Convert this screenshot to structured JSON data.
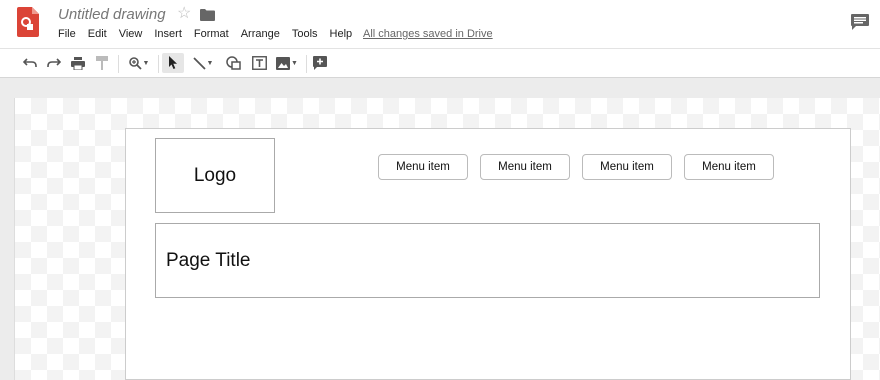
{
  "header": {
    "doc_title": "Untitled drawing",
    "save_status": "All changes saved in Drive",
    "menu": [
      "File",
      "Edit",
      "View",
      "Insert",
      "Format",
      "Arrange",
      "Tools",
      "Help"
    ]
  },
  "toolbar": {
    "icons": [
      "undo-icon",
      "redo-icon",
      "print-icon",
      "paint-format-icon",
      "zoom-icon",
      "select-icon",
      "line-icon",
      "shape-icon",
      "text-box-icon",
      "image-icon",
      "add-comment-icon"
    ]
  },
  "canvas": {
    "logo_label": "Logo",
    "menu_items": [
      "Menu item",
      "Menu item",
      "Menu item",
      "Menu item"
    ],
    "page_title": "Page Title"
  },
  "colors": {
    "brand_red": "#db4437",
    "text": "#222222",
    "muted": "#777777"
  }
}
